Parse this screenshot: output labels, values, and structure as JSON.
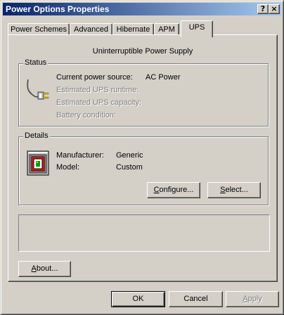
{
  "window": {
    "title": "Power Options Properties",
    "help_glyph": "?",
    "close_glyph": "×"
  },
  "tabs": [
    {
      "label": "Power Schemes"
    },
    {
      "label": "Advanced"
    },
    {
      "label": "Hibernate"
    },
    {
      "label": "APM"
    },
    {
      "label": "UPS"
    }
  ],
  "active_tab": "UPS",
  "panel": {
    "heading": "Uninterruptible Power Supply"
  },
  "status": {
    "label": "Status",
    "rows": [
      {
        "label": "Current power source:",
        "value": "AC Power"
      },
      {
        "label": "Estimated UPS runtime:",
        "value": ""
      },
      {
        "label": "Estimated UPS capacity:",
        "value": ""
      },
      {
        "label": "Battery condition:",
        "value": ""
      }
    ]
  },
  "details": {
    "label": "Details",
    "manufacturer_label": "Manufacturer:",
    "manufacturer_value": "Generic",
    "model_label": "Model:",
    "model_value": "Custom",
    "configure_pre": "",
    "configure_u": "C",
    "configure_post": "onfigure...",
    "select_pre": "",
    "select_u": "S",
    "select_post": "elect..."
  },
  "about": {
    "pre": "",
    "u": "A",
    "post": "bout..."
  },
  "footer": {
    "ok": "OK",
    "cancel": "Cancel",
    "apply_pre": "",
    "apply_u": "A",
    "apply_post": "pply"
  }
}
